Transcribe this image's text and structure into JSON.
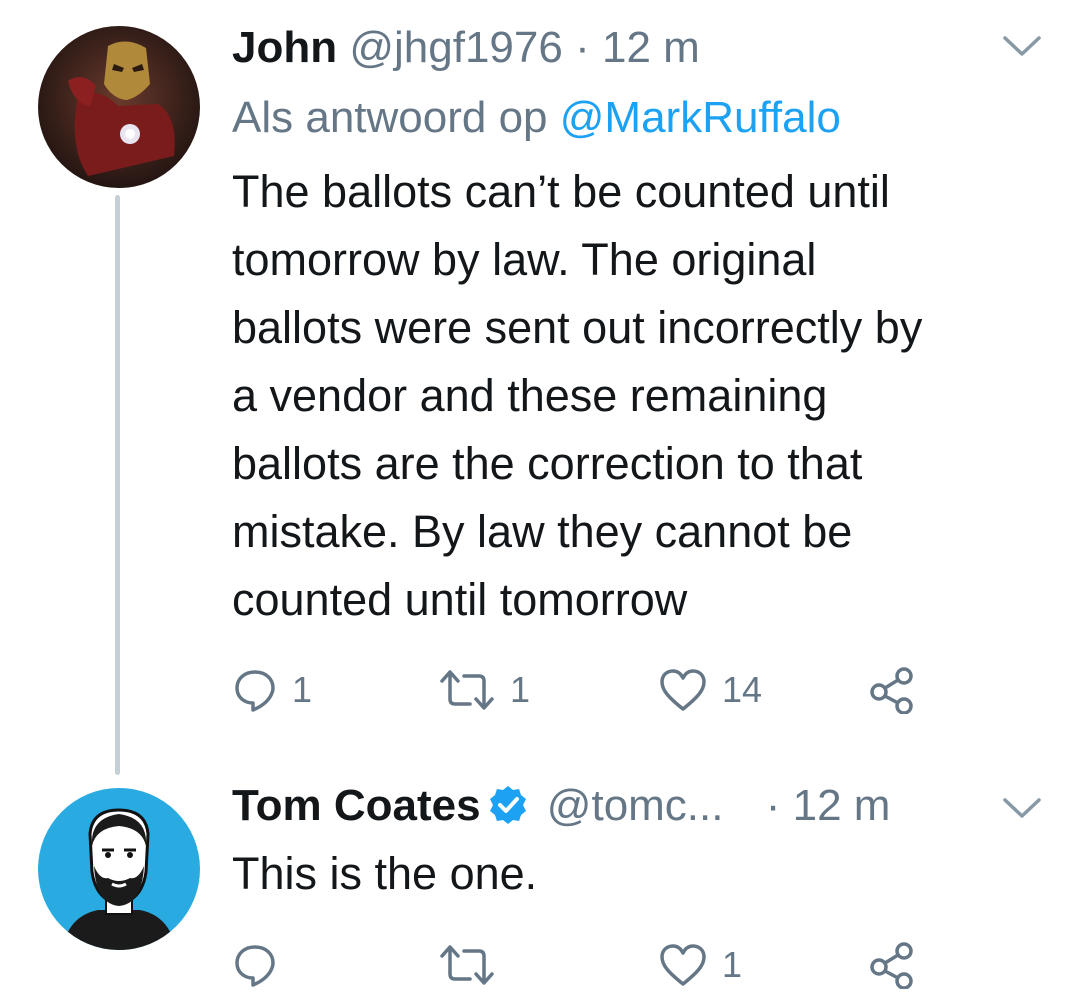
{
  "tweet1": {
    "name": "John",
    "handle": "@jhgf1976",
    "dot": "·",
    "time": "12 m",
    "reply_prefix": "Als antwoord op",
    "reply_to": "@MarkRuffalo",
    "lines": [
      "The ballots can’t be counted until",
      "tomorrow by law. The original",
      "ballots were sent out incorrectly by",
      "a vendor and these remaining",
      "ballots are the correction to that",
      "mistake. By law they cannot be",
      "counted until tomorrow"
    ],
    "replies": "1",
    "retweets": "1",
    "likes": "14"
  },
  "tweet2": {
    "name": "Tom Coates",
    "handle": "@tomc...",
    "dot": "·",
    "time": "12 m",
    "text": "This is the one.",
    "likes": "1"
  },
  "icons": {
    "reply": "reply-icon",
    "retweet": "retweet-icon",
    "like": "heart-icon",
    "share": "share-icon",
    "more": "chevron-down-icon",
    "verified": "verified-badge-icon"
  },
  "colors": {
    "text": "#14171a",
    "muted": "#657786",
    "link": "#1da1f2",
    "thread_line": "#c4cfd6"
  }
}
